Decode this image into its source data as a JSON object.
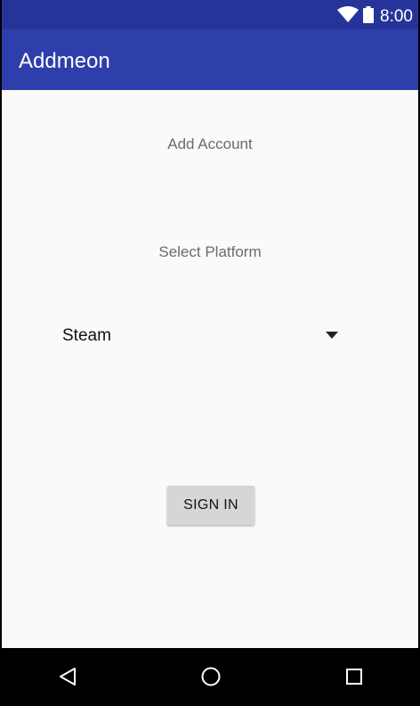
{
  "status_bar": {
    "time": "8:00",
    "icons": [
      "wifi-icon",
      "battery-icon"
    ]
  },
  "app_bar": {
    "title": "Addmeon",
    "color": "#2e3fab"
  },
  "main": {
    "heading": "Add Account",
    "subheading": "Select Platform",
    "platform_spinner": {
      "selected": "Steam",
      "icon": "dropdown-arrow-icon"
    },
    "sign_in_label": "SIGN IN"
  },
  "nav_bar": {
    "icons": [
      "back-icon",
      "home-icon",
      "recents-icon"
    ]
  },
  "colors": {
    "status_bar": "#26349a",
    "background": "#fafafa",
    "button": "#d6d6d6"
  }
}
